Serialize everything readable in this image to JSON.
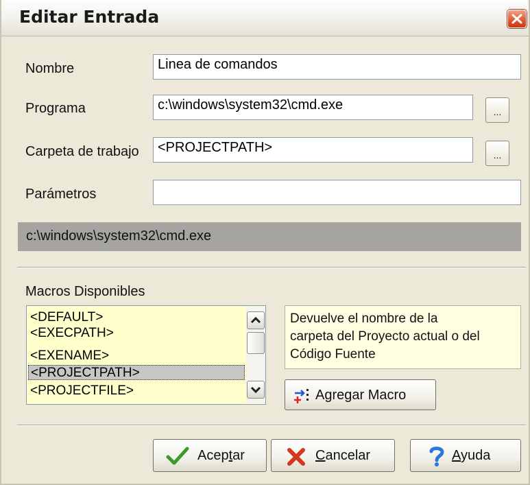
{
  "window": {
    "title": "Editar Entrada"
  },
  "form": {
    "nombre": {
      "label": "Nombre",
      "value": "Linea de comandos"
    },
    "programa": {
      "label": "Programa",
      "value": "c:\\windows\\system32\\cmd.exe",
      "browse_label": "..."
    },
    "carpeta": {
      "label": "Carpeta de trabajo",
      "value": "<PROJECTPATH>",
      "browse_label": "..."
    },
    "parametros": {
      "label": "Parámetros",
      "value": ""
    },
    "command_preview": "c:\\windows\\system32\\cmd.exe"
  },
  "macros": {
    "label": "Macros Disponibles",
    "items": [
      "<DEFAULT>",
      "<EXECPATH>",
      "<EXENAME>",
      "<PROJECTPATH>",
      "<PROJECTFILE>"
    ],
    "selected": "<PROJECTPATH>",
    "description": [
      "Devuelve el nombre de la",
      "carpeta del Proyecto actual o del",
      "Código Fuente"
    ],
    "add_button": "Agregar Macro"
  },
  "buttons": {
    "ok": {
      "before": "Acep",
      "mnemonic": "t",
      "after": "ar"
    },
    "cancel": {
      "before": "",
      "mnemonic": "C",
      "after": "ancelar"
    },
    "help": {
      "before": "",
      "mnemonic": "A",
      "after": "yuda"
    }
  },
  "colors": {
    "dialog_bg": "#ece9d8",
    "list_bg": "#ffffcc",
    "close_button": "#e0532c",
    "preview_bar": "#a6a4a1"
  },
  "icons": [
    "close-icon",
    "checkmark-icon",
    "cross-icon",
    "question-icon",
    "add-macro-icon"
  ]
}
